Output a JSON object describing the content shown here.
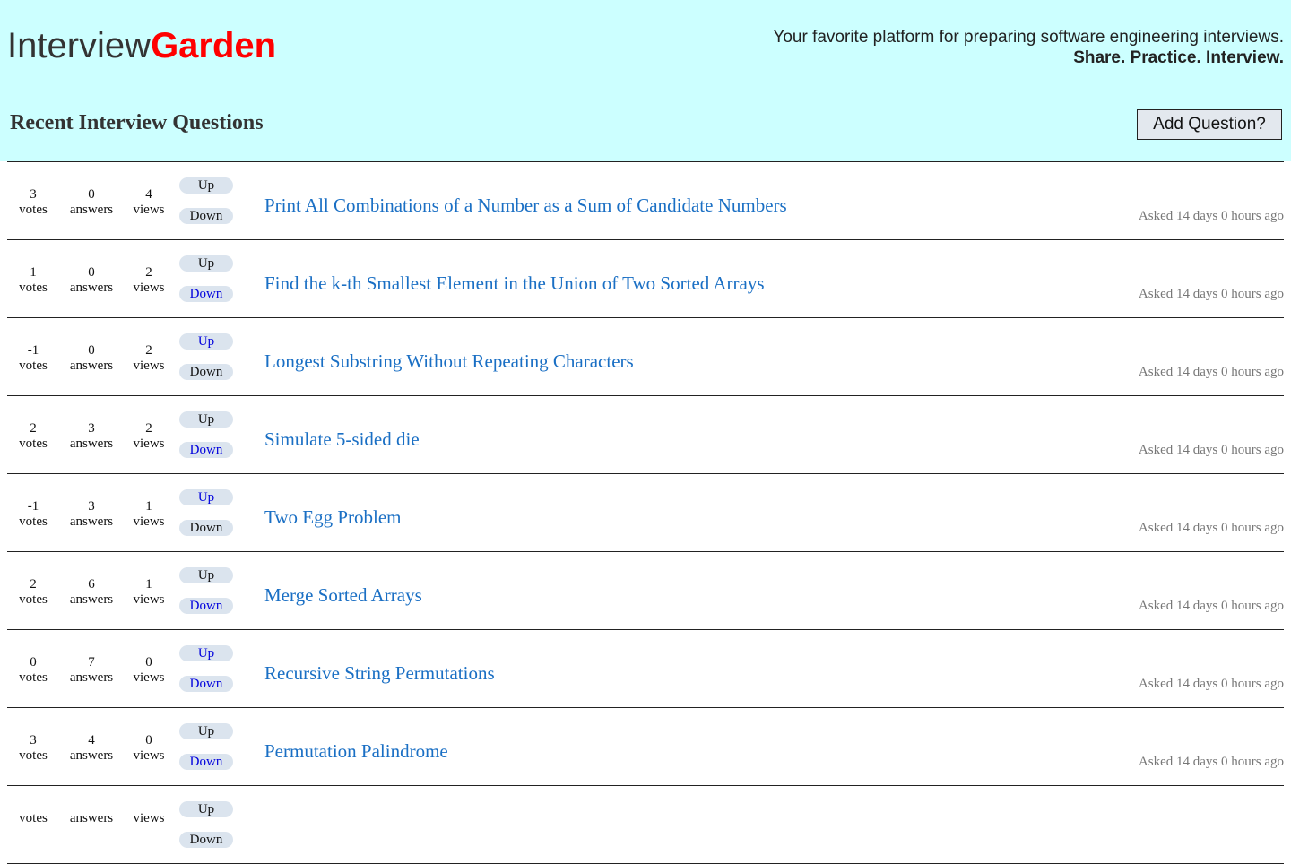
{
  "header": {
    "logo_plain": "Interview",
    "logo_accent": "Garden",
    "tagline": "Your favorite platform for preparing software engineering interviews.",
    "motto": "Share. Practice. Interview.",
    "section_title": "Recent Interview Questions",
    "add_button": "Add Question?"
  },
  "labels": {
    "votes": "votes",
    "answers": "answers",
    "views": "views",
    "up": "Up",
    "down": "Down"
  },
  "colors": {
    "header_bg": "#ccffff",
    "logo_accent": "#ff0000",
    "question_link": "#1a6fc4",
    "vote_active": "#0000dd"
  },
  "questions": [
    {
      "votes": "3",
      "answers": "0",
      "views": "4",
      "title": "Print All Combinations of a Number as a Sum of Candidate Numbers",
      "asked": "Asked 14 days 0 hours ago",
      "up_active": false,
      "down_active": false
    },
    {
      "votes": "1",
      "answers": "0",
      "views": "2",
      "title": "Find the k-th Smallest Element in the Union of Two Sorted Arrays",
      "asked": "Asked 14 days 0 hours ago",
      "up_active": false,
      "down_active": true
    },
    {
      "votes": "-1",
      "answers": "0",
      "views": "2",
      "title": "Longest Substring Without Repeating Characters",
      "asked": "Asked 14 days 0 hours ago",
      "up_active": true,
      "down_active": false
    },
    {
      "votes": "2",
      "answers": "3",
      "views": "2",
      "title": "Simulate 5-sided die",
      "asked": "Asked 14 days 0 hours ago",
      "up_active": false,
      "down_active": true
    },
    {
      "votes": "-1",
      "answers": "3",
      "views": "1",
      "title": "Two Egg Problem",
      "asked": "Asked 14 days 0 hours ago",
      "up_active": true,
      "down_active": false
    },
    {
      "votes": "2",
      "answers": "6",
      "views": "1",
      "title": "Merge Sorted Arrays",
      "asked": "Asked 14 days 0 hours ago",
      "up_active": false,
      "down_active": true
    },
    {
      "votes": "0",
      "answers": "7",
      "views": "0",
      "title": "Recursive String Permutations",
      "asked": "Asked 14 days 0 hours ago",
      "up_active": true,
      "down_active": true
    },
    {
      "votes": "3",
      "answers": "4",
      "views": "0",
      "title": "Permutation Palindrome",
      "asked": "Asked 14 days 0 hours ago",
      "up_active": false,
      "down_active": true
    },
    {
      "votes": "",
      "answers": "",
      "views": "",
      "title": "",
      "asked": "",
      "up_active": false,
      "down_active": false
    }
  ]
}
